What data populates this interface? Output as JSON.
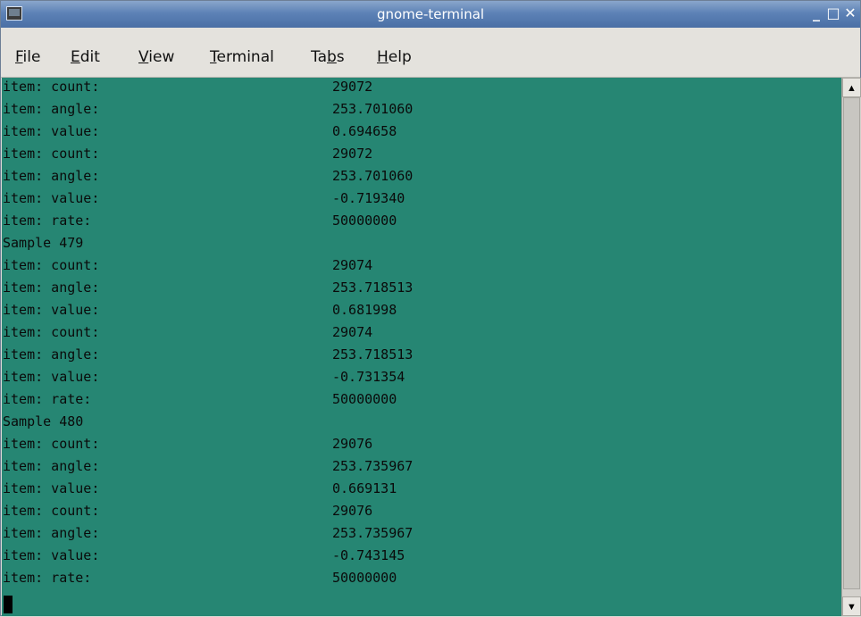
{
  "window": {
    "title": "gnome-terminal",
    "controls": {
      "minimize": "_",
      "maximize": "□",
      "close": "✕"
    }
  },
  "menu": {
    "file": {
      "mnemonic": "F",
      "rest": "ile"
    },
    "edit": {
      "mnemonic": "E",
      "rest": "dit"
    },
    "view": {
      "mnemonic": "V",
      "rest": "iew"
    },
    "terminal": {
      "mnemonic": "T",
      "rest": "erminal"
    },
    "tabs": {
      "before": "Ta",
      "mnemonic": "b",
      "rest": "s"
    },
    "help": {
      "mnemonic": "H",
      "rest": "elp"
    }
  },
  "terminal": {
    "lines": [
      {
        "label": "item: count:",
        "value": "29072"
      },
      {
        "label": "item: angle:",
        "value": "253.701060"
      },
      {
        "label": "item: value:",
        "value": "0.694658"
      },
      {
        "label": "item: count:",
        "value": "29072"
      },
      {
        "label": "item: angle:",
        "value": "253.701060"
      },
      {
        "label": "item: value:",
        "value": "-0.719340"
      },
      {
        "label": "item: rate:",
        "value": "50000000"
      },
      {
        "label": "Sample 479",
        "value": ""
      },
      {
        "label": "item: count:",
        "value": "29074"
      },
      {
        "label": "item: angle:",
        "value": "253.718513"
      },
      {
        "label": "item: value:",
        "value": "0.681998"
      },
      {
        "label": "item: count:",
        "value": "29074"
      },
      {
        "label": "item: angle:",
        "value": "253.718513"
      },
      {
        "label": "item: value:",
        "value": "-0.731354"
      },
      {
        "label": "item: rate:",
        "value": "50000000"
      },
      {
        "label": "Sample 480",
        "value": ""
      },
      {
        "label": "item: count:",
        "value": "29076"
      },
      {
        "label": "item: angle:",
        "value": "253.735967"
      },
      {
        "label": "item: value:",
        "value": "0.669131"
      },
      {
        "label": "item: count:",
        "value": "29076"
      },
      {
        "label": "item: angle:",
        "value": "253.735967"
      },
      {
        "label": "item: value:",
        "value": "-0.743145"
      },
      {
        "label": "item: rate:",
        "value": "50000000"
      }
    ]
  },
  "scrollbar": {
    "up": "▲",
    "down": "▼"
  }
}
